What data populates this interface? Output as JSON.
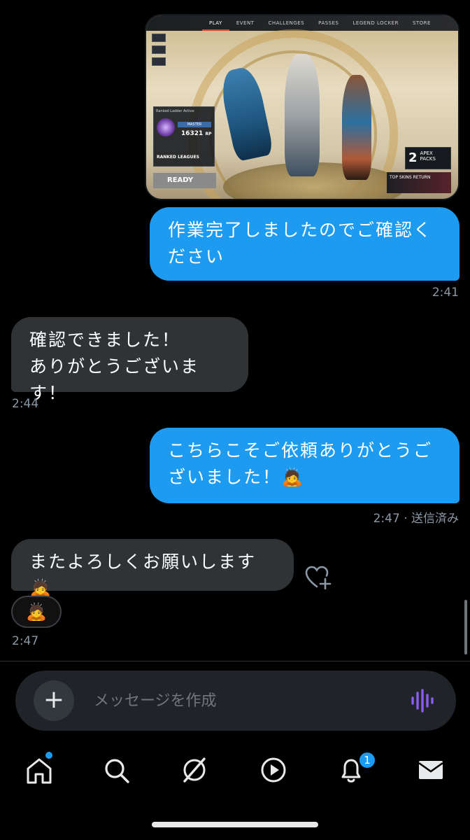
{
  "conversation": {
    "messages": [
      {
        "direction": "out",
        "type": "image"
      },
      {
        "direction": "out",
        "text": "作業完了しましたのでご確認ください",
        "time": "2:41"
      },
      {
        "direction": "in",
        "line1": "確認できました！",
        "line2": "ありがとうございます！",
        "time": "2:44"
      },
      {
        "direction": "out",
        "text": "こちらこそご依頼ありがとうございました！🙇",
        "time": "2:47 · 送信済み"
      },
      {
        "direction": "in",
        "text": "またよろしくお願いします🙇",
        "reaction": "🙇",
        "time": "2:47"
      }
    ]
  },
  "game_screenshot": {
    "tabs": [
      "PLAY",
      "EVENT",
      "CHALLENGES",
      "PASSES",
      "LEGEND LOCKER",
      "STORE"
    ],
    "ranked_label": "Ranked Ladder Active",
    "rank_title": "MASTER",
    "rank_points": "16321",
    "rank_unit": "RP",
    "mode": "RANKED LEAGUES",
    "ready": "READY",
    "packs_count": "2",
    "packs_label": "APEX PACKS",
    "skins_label": "TOP SKINS RETURN"
  },
  "composer": {
    "placeholder": "メッセージを作成",
    "plus_icon": "+"
  },
  "tabbar": {
    "notification_count": "1",
    "items": [
      "home-icon",
      "search-icon",
      "grok-icon",
      "video-icon",
      "bell-icon",
      "mail-icon"
    ]
  },
  "colors": {
    "accent": "#1d9bf0",
    "incoming_bubble": "#2f3336",
    "voice_icon": "#8b5cf6"
  }
}
